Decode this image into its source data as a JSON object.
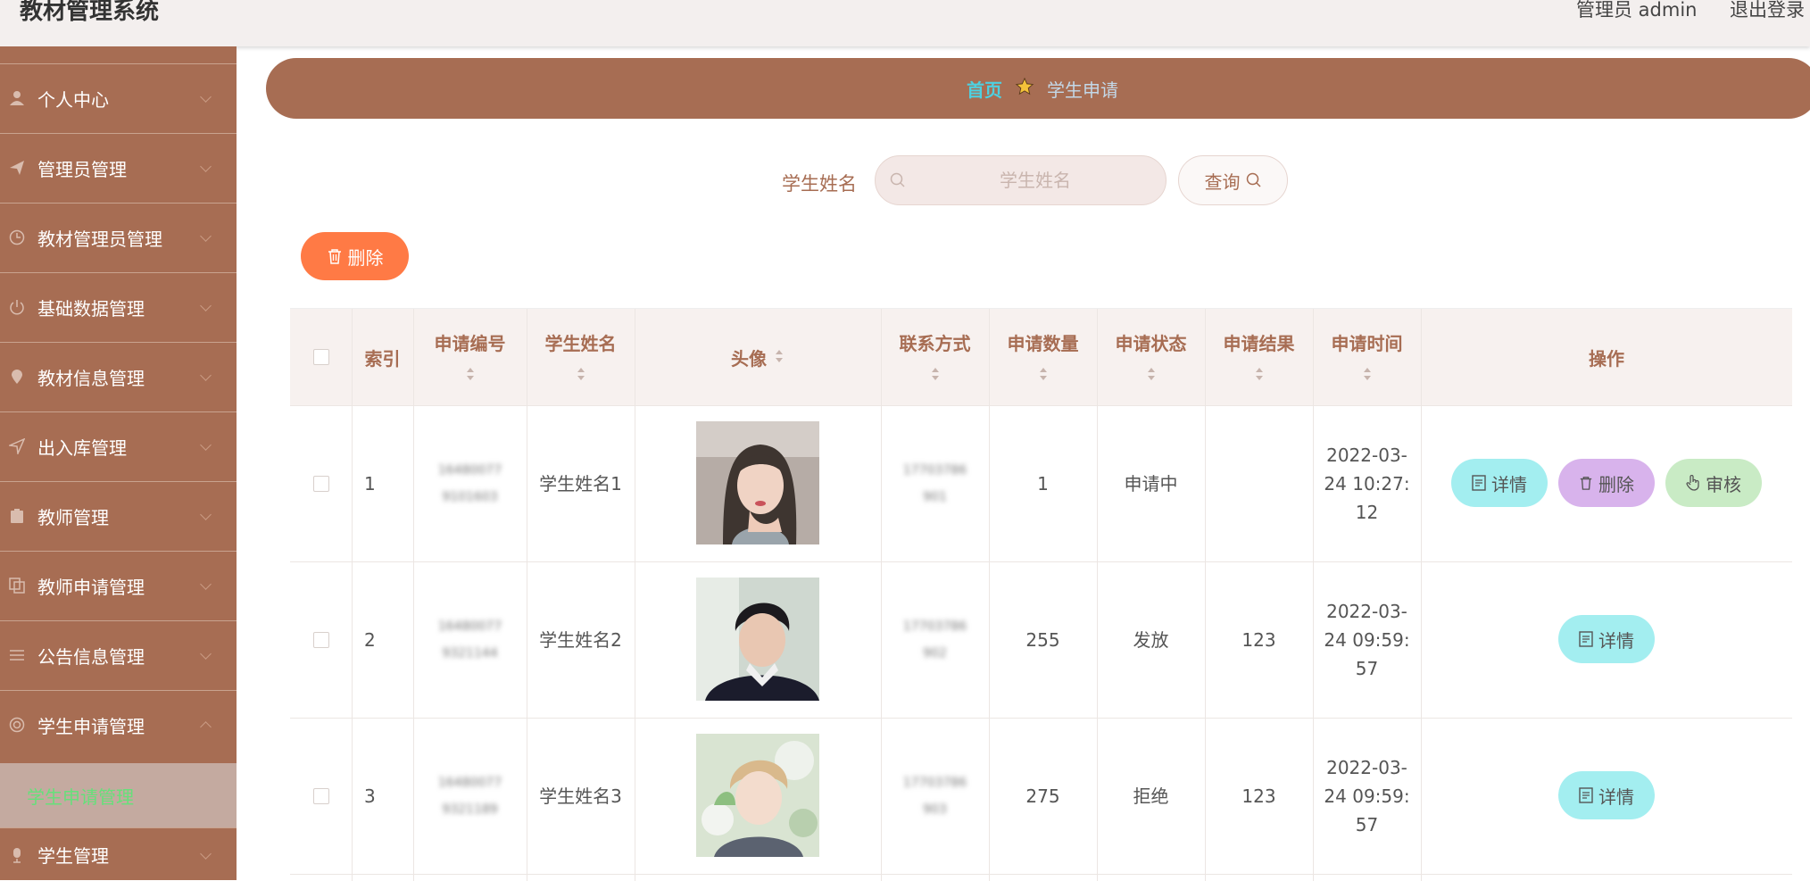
{
  "header": {
    "title": "教材管理系统",
    "admin": "管理员 admin",
    "logout": "退出登录"
  },
  "sidebar": {
    "items": [
      {
        "label": "个人中心",
        "icon": "user-icon"
      },
      {
        "label": "管理员管理",
        "icon": "send-icon"
      },
      {
        "label": "教材管理员管理",
        "icon": "clock-icon"
      },
      {
        "label": "基础数据管理",
        "icon": "power-icon"
      },
      {
        "label": "教材信息管理",
        "icon": "location-icon"
      },
      {
        "label": "出入库管理",
        "icon": "navigation-icon"
      },
      {
        "label": "教师管理",
        "icon": "clipboard-icon"
      },
      {
        "label": "教师申请管理",
        "icon": "copy-icon"
      },
      {
        "label": "公告信息管理",
        "icon": "sliders-icon"
      },
      {
        "label": "学生申请管理",
        "icon": "circle-icon"
      },
      {
        "label": "学生管理",
        "icon": "mic-icon"
      }
    ],
    "active_sub": "学生申请管理"
  },
  "breadcrumb": {
    "home": "首页",
    "current": "学生申请"
  },
  "search": {
    "label": "学生姓名",
    "placeholder": "学生姓名",
    "button": "查询"
  },
  "actions": {
    "delete": "删除"
  },
  "table": {
    "headers": {
      "index": "索引",
      "apply_no": "申请编号",
      "student_name": "学生姓名",
      "avatar": "头像",
      "contact": "联系方式",
      "quantity": "申请数量",
      "status": "申请状态",
      "result": "申请结果",
      "time": "申请时间",
      "ops": "操作"
    },
    "rows": [
      {
        "index": "1",
        "apply_no_a": "16480077",
        "apply_no_b": "9101603",
        "name": "学生姓名1",
        "contact_a": "17703786",
        "contact_b": "901",
        "quantity": "1",
        "status": "申请中",
        "result": "",
        "time_a": "2022-03-",
        "time_b": "24 10:27:",
        "time_c": "12"
      },
      {
        "index": "2",
        "apply_no_a": "16480077",
        "apply_no_b": "9321144",
        "name": "学生姓名2",
        "contact_a": "17703786",
        "contact_b": "902",
        "quantity": "255",
        "status": "发放",
        "result": "123",
        "time_a": "2022-03-",
        "time_b": "24 09:59:",
        "time_c": "57"
      },
      {
        "index": "3",
        "apply_no_a": "16480077",
        "apply_no_b": "9321189",
        "name": "学生姓名3",
        "contact_a": "17703786",
        "contact_b": "903",
        "quantity": "275",
        "status": "拒绝",
        "result": "123",
        "time_a": "2022-03-",
        "time_b": "24 09:59:",
        "time_c": "57"
      }
    ],
    "buttons": {
      "detail": "详情",
      "delete": "删除",
      "audit": "审核"
    }
  },
  "colors": {
    "brand": "#a76d53",
    "accent": "#4ed0e0",
    "danger": "#ff7a45"
  }
}
